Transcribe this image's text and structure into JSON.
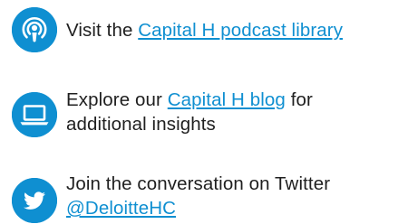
{
  "colors": {
    "accent": "#0f8fd1",
    "text": "#1f1f1f",
    "background": "#ffffff"
  },
  "items": [
    {
      "icon": "podcast-icon",
      "prefix": "Visit the ",
      "link": "Capital H podcast library",
      "suffix": ""
    },
    {
      "icon": "laptop-icon",
      "prefix": "Explore our ",
      "link": "Capital H blog",
      "suffix": " for",
      "line2": "additional insights"
    },
    {
      "icon": "twitter-icon",
      "line1": "Join the conversation on Twitter",
      "link": "@DeloitteHC"
    }
  ]
}
